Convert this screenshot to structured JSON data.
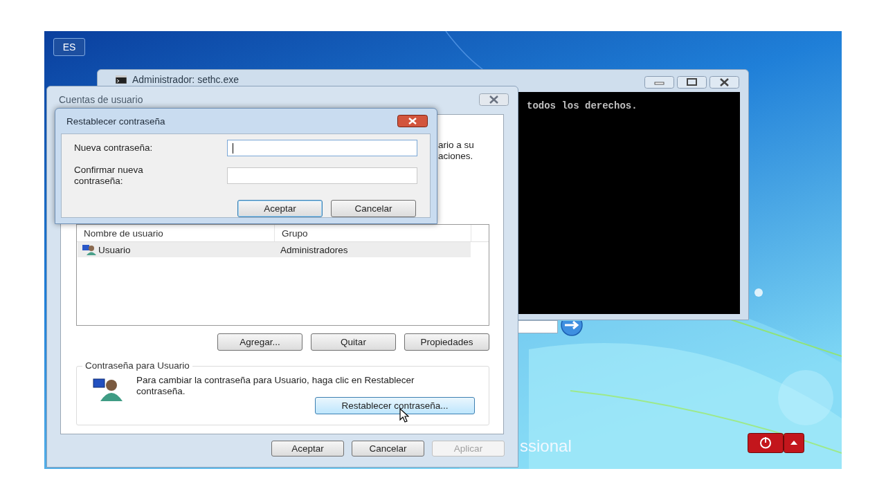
{
  "desktop": {
    "language_button": "ES",
    "edition_text": "ssional"
  },
  "console_window": {
    "title": "Administrador: sethc.exe",
    "lines": [
      "todos los derechos."
    ]
  },
  "user_accounts_window": {
    "title": "Cuentas de usuario",
    "intro_lines": [
      "ario a su",
      "aciones."
    ],
    "list": {
      "columns": [
        "Nombre de usuario",
        "Grupo"
      ],
      "rows": [
        {
          "cells": [
            "Usuario",
            "Administradores"
          ],
          "selected": true
        }
      ]
    },
    "list_buttons": [
      "Agregar...",
      "Quitar",
      "Propiedades"
    ],
    "password_group": {
      "title": "Contraseña para Usuario",
      "text": "Para cambiar la contraseña para Usuario, haga clic en Restablecer contraseña.",
      "button": {
        "label": "Restablecer contraseña...",
        "highlighted": true
      }
    },
    "buttons": [
      {
        "label": "Aceptar",
        "disabled": false
      },
      {
        "label": "Cancelar",
        "disabled": false
      },
      {
        "label": "Aplicar",
        "disabled": true
      }
    ]
  },
  "reset_dialog": {
    "title": "Restablecer contraseña",
    "fields": [
      {
        "label": "Nueva contraseña:",
        "focused": true
      },
      {
        "label": "Confirmar nueva contraseña:",
        "focused": false
      }
    ],
    "buttons": [
      {
        "label": "Aceptar",
        "default": true
      },
      {
        "label": "Cancelar",
        "default": false
      }
    ]
  }
}
